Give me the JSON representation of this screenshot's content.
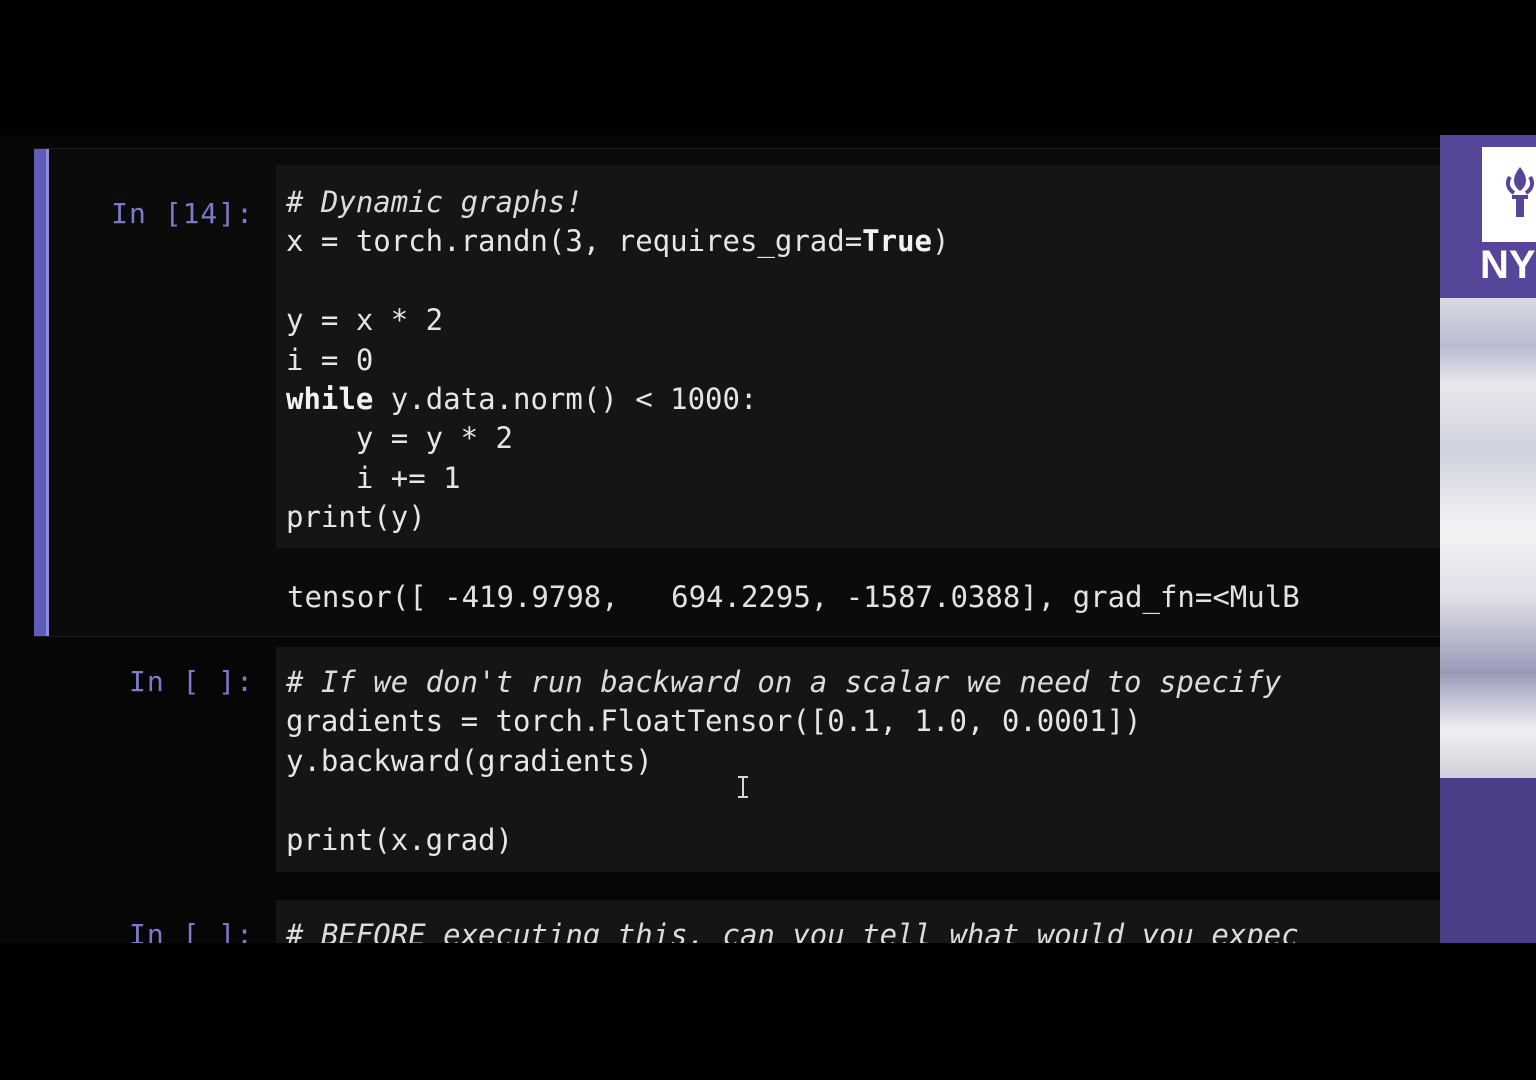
{
  "theme": {
    "background": "#000000",
    "cell_background": "#141515",
    "prompt_color": "#7c7bc9",
    "selection_bar": "#5f5cb8",
    "side_panel": "#4a3f86"
  },
  "cells": [
    {
      "prompt": "In [14]:",
      "code_lines": [
        "# Dynamic graphs!",
        "x = torch.randn(3, requires_grad=True)",
        "",
        "y = x * 2",
        "i = 0",
        "while y.data.norm() < 1000:",
        "    y = y * 2",
        "    i += 1",
        "print(y)"
      ],
      "output": "tensor([ -419.9798,   694.2295, -1587.0388], grad_fn=<MulB"
    },
    {
      "prompt": "In [ ]:",
      "code_lines": [
        "# If we don't run backward on a scalar we need to specify",
        "gradients = torch.FloatTensor([0.1, 1.0, 0.0001])",
        "y.backward(gradients)",
        "",
        "print(x.grad)"
      ]
    },
    {
      "prompt": "In [ ]:",
      "code_lines": [
        "# BEFORE executing this, can you tell what would you expec"
      ]
    }
  ],
  "side_panel": {
    "logo_text": "NY"
  },
  "icons": {
    "cursor": "text-cursor-icon",
    "logo": "torch-logo-icon"
  }
}
